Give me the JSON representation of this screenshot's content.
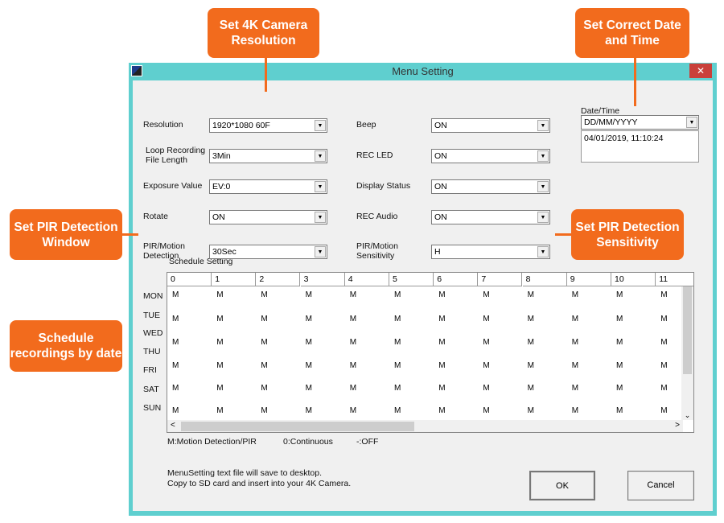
{
  "window": {
    "title": "Menu Setting",
    "close": "✕"
  },
  "callouts": {
    "resolution": "Set 4K Camera Resolution",
    "datetime": "Set Correct Date and Time",
    "pir_window": "Set PIR Detection Window",
    "pir_sensitivity": "Set PIR Detection Sensitivity",
    "schedule": "Schedule recordings by date"
  },
  "fields": [
    {
      "label": "Resolution",
      "value": "1920*1080 60F"
    },
    {
      "label": "Loop Recording File Length",
      "value": "3Min"
    },
    {
      "label": "Exposure Value",
      "value": "EV:0"
    },
    {
      "label": "Rotate",
      "value": "ON"
    },
    {
      "label": "PIR/Motion Detection",
      "value": "30Sec"
    },
    {
      "label": "Beep",
      "value": "ON"
    },
    {
      "label": "REC LED",
      "value": "ON"
    },
    {
      "label": "Display Status",
      "value": "ON"
    },
    {
      "label": "REC Audio",
      "value": "ON"
    },
    {
      "label": "PIR/Motion Sensitivity",
      "value": "H"
    }
  ],
  "datetime": {
    "label": "Date/Time",
    "format": "DD/MM/YYYY",
    "value": "04/01/2019, 11:10:24"
  },
  "schedule": {
    "label": "Schedule Setting",
    "hours": [
      "0",
      "1",
      "2",
      "3",
      "4",
      "5",
      "6",
      "7",
      "8",
      "9",
      "10",
      "11"
    ],
    "days": [
      "MON",
      "TUE",
      "WED",
      "THU",
      "FRI",
      "SAT",
      "SUN"
    ],
    "cell_value": "M"
  },
  "legend": {
    "m": "M:Motion Detection/PIR",
    "o": "0:Continuous",
    "off": "-:OFF"
  },
  "message": {
    "line1": "MenuSetting text file will save to desktop.",
    "line2": "Copy to SD card and insert into your 4K Camera."
  },
  "buttons": {
    "ok": "OK",
    "cancel": "Cancel"
  },
  "colors": {
    "accent": "#f26b1d",
    "titlebar": "#5fcfcf"
  }
}
